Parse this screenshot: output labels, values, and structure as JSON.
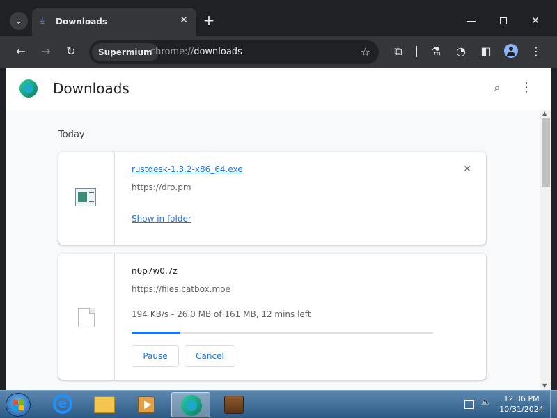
{
  "window": {
    "tab_title": "Downloads",
    "new_tab_icon": "plus-icon"
  },
  "toolbar": {
    "chip_label": "Supermium",
    "url_scheme": "chrome://",
    "url_host": "downloads"
  },
  "page": {
    "title": "Downloads",
    "section_label": "Today"
  },
  "downloads": [
    {
      "file_name": "rustdesk-1.3.2-x86_64.exe",
      "source_url": "https://dro.pm",
      "action_link": "Show in folder",
      "icon": "exe-file-icon"
    },
    {
      "file_name": "n6p7w0.7z",
      "source_url": "https://files.catbox.moe",
      "progress_text": "194 KB/s - 26.0 MB of 161 MB, 12 mins left",
      "progress_fraction": 0.161,
      "pause_label": "Pause",
      "cancel_label": "Cancel",
      "icon": "generic-file-icon"
    }
  ],
  "taskbar": {
    "apps": [
      "internet-explorer",
      "windows-explorer",
      "media-player",
      "supermium-browser",
      "winrar"
    ],
    "time": "12:36 PM",
    "date": "10/31/2024"
  },
  "colors": {
    "accent": "#1a73e8",
    "tab_strip": "#202124",
    "toolbar": "#35363a",
    "page_bg": "#f8f9fa"
  }
}
